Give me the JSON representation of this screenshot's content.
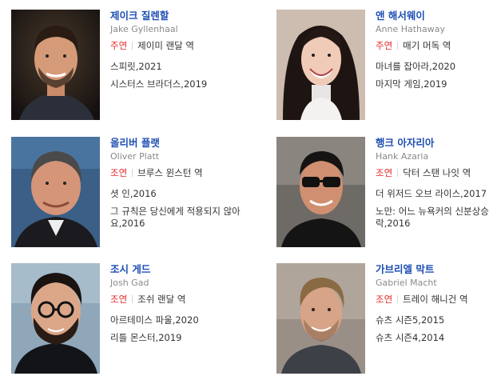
{
  "cast": [
    {
      "name_ko": "제이크 질렌할",
      "name_en": "Jake Gyllenhaal",
      "role_type": "주연",
      "role_name": "제이미 랜달 역",
      "works": [
        "스피릿,2021",
        "시스터스 브라더스,2019"
      ]
    },
    {
      "name_ko": "앤 해서웨이",
      "name_en": "Anne Hathaway",
      "role_type": "주연",
      "role_name": "매기 머독 역",
      "works": [
        "마녀를 잡아라,2020",
        "마지막 게임,2019"
      ]
    },
    {
      "name_ko": "올리버 플랫",
      "name_en": "Oliver Platt",
      "role_type": "조연",
      "role_name": "브루스 윈스턴 역",
      "works": [
        "셧 인,2016",
        "그 규칙은 당신에게 적용되지 않아요,2016"
      ]
    },
    {
      "name_ko": "행크 아자리아",
      "name_en": "Hank Azaria",
      "role_type": "조연",
      "role_name": "닥터 스탠 나잇 역",
      "works": [
        "더 위저드 오브 라이스,2017",
        "노만: 어느 뉴욕커의 신분상승락,2016"
      ]
    },
    {
      "name_ko": "조시 게드",
      "name_en": "Josh Gad",
      "role_type": "조연",
      "role_name": "조쉬 랜달 역",
      "works": [
        "아르테미스 파울,2020",
        "리틀 몬스터,2019"
      ]
    },
    {
      "name_ko": "가브리엘 막트",
      "name_en": "Gabriel Macht",
      "role_type": "조연",
      "role_name": "트레이 해니건 역",
      "works": [
        "슈츠 시즌5,2015",
        "슈츠 시즌4,2014"
      ]
    }
  ]
}
